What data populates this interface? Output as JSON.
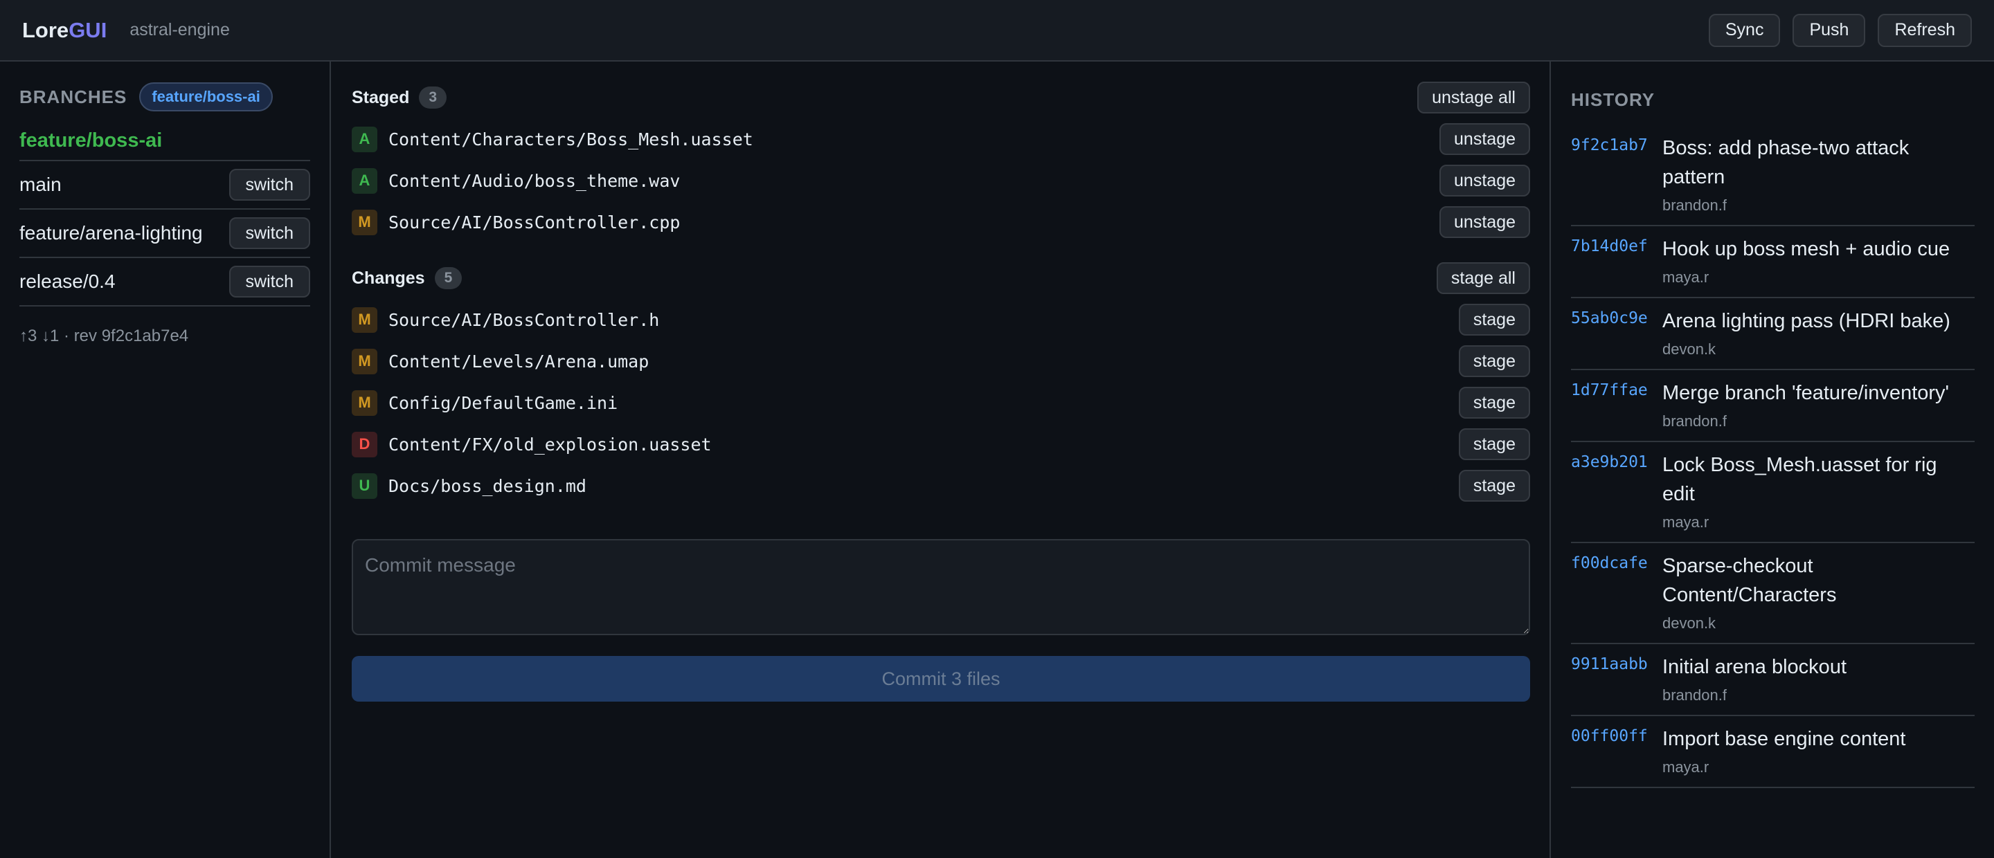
{
  "app": {
    "name_main": "Lore",
    "name_accent": "GUI",
    "repo": "astral-engine"
  },
  "topbar": {
    "sync_label": "Sync",
    "push_label": "Push",
    "refresh_label": "Refresh"
  },
  "branches": {
    "title": "BRANCHES",
    "current_pill": "feature/boss-ai",
    "current": "feature/boss-ai",
    "switch_label": "switch",
    "others": [
      "main",
      "feature/arena-lighting",
      "release/0.4"
    ],
    "rev_info": "↑3 ↓1 · rev 9f2c1ab7e4"
  },
  "staged": {
    "title": "Staged",
    "count": "3",
    "action_all": "unstage all",
    "action": "unstage",
    "files": [
      {
        "status": "A",
        "path": "Content/Characters/Boss_Mesh.uasset"
      },
      {
        "status": "A",
        "path": "Content/Audio/boss_theme.wav"
      },
      {
        "status": "M",
        "path": "Source/AI/BossController.cpp"
      }
    ]
  },
  "changes": {
    "title": "Changes",
    "count": "5",
    "action_all": "stage all",
    "action": "stage",
    "files": [
      {
        "status": "M",
        "path": "Source/AI/BossController.h"
      },
      {
        "status": "M",
        "path": "Content/Levels/Arena.umap"
      },
      {
        "status": "M",
        "path": "Config/DefaultGame.ini"
      },
      {
        "status": "D",
        "path": "Content/FX/old_explosion.uasset"
      },
      {
        "status": "U",
        "path": "Docs/boss_design.md"
      }
    ]
  },
  "commit": {
    "placeholder": "Commit message",
    "button_label": "Commit 3 files"
  },
  "history": {
    "title": "HISTORY",
    "items": [
      {
        "hash": "9f2c1ab7",
        "message": "Boss: add phase-two attack pattern",
        "author": "brandon.f"
      },
      {
        "hash": "7b14d0ef",
        "message": "Hook up boss mesh + audio cue",
        "author": "maya.r"
      },
      {
        "hash": "55ab0c9e",
        "message": "Arena lighting pass (HDRI bake)",
        "author": "devon.k"
      },
      {
        "hash": "1d77ffae",
        "message": "Merge branch 'feature/inventory'",
        "author": "brandon.f"
      },
      {
        "hash": "a3e9b201",
        "message": "Lock Boss_Mesh.uasset for rig edit",
        "author": "maya.r"
      },
      {
        "hash": "f00dcafe",
        "message": "Sparse-checkout Content/Characters",
        "author": "devon.k"
      },
      {
        "hash": "9911aabb",
        "message": "Initial arena blockout",
        "author": "brandon.f"
      },
      {
        "hash": "00ff00ff",
        "message": "Import base engine content",
        "author": "maya.r"
      }
    ]
  },
  "colors": {
    "background": "#0d1117",
    "panel": "#161b22",
    "accent_logo": "#7b7cf0",
    "branch_current": "#3fb950",
    "hash": "#58a6ff",
    "status_added": "#3fb950",
    "status_modified": "#d29922",
    "status_deleted": "#f85149",
    "commit_button": "#1f3a64"
  }
}
